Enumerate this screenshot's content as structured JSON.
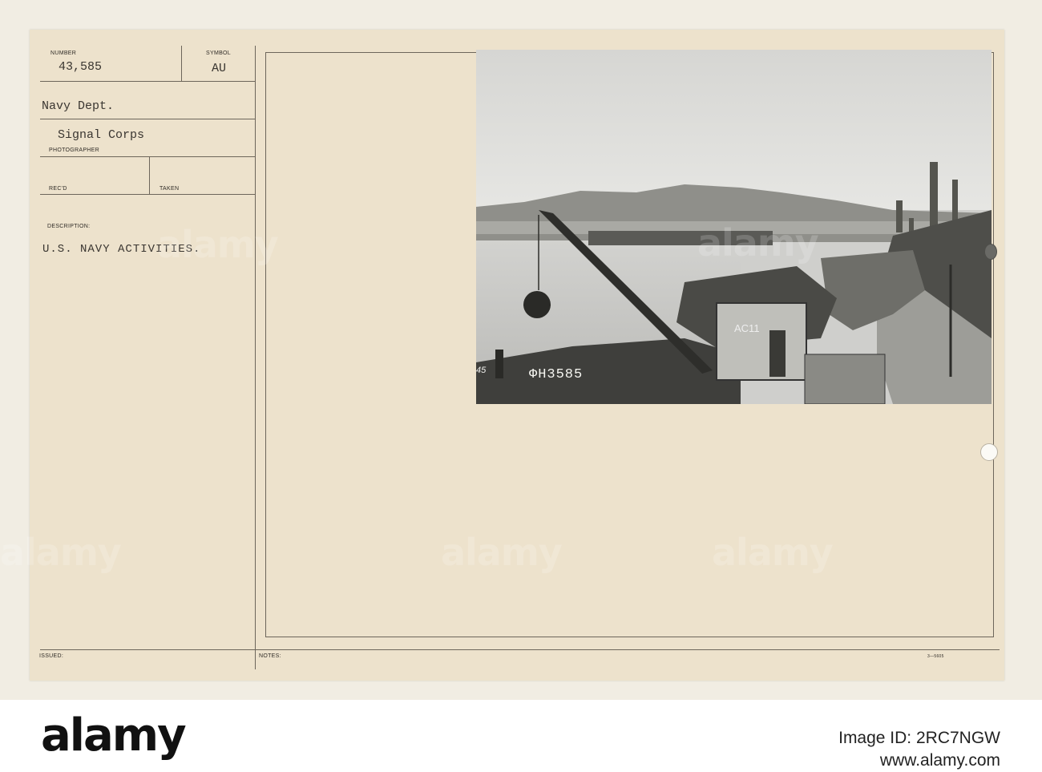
{
  "card": {
    "number_label": "NUMBER",
    "number_value": "43,585",
    "symbol_label": "SYMBOL",
    "symbol_value": "AU",
    "dept": "Navy Dept.",
    "corps": "Signal Corps",
    "photographer_label": "PHOTOGRAPHER",
    "recd_label": "REC'D",
    "taken_label": "TAKEN",
    "description_label": "DESCRIPTION:",
    "description_value": "U.S. NAVY ACTIVITIES.",
    "issued_label": "ISSUED:",
    "notes_label": "NOTES:",
    "form_code": "3—5605"
  },
  "photo": {
    "negative_number": "ΦH3585",
    "crane_marking": "AC11",
    "edge_marking": "45"
  },
  "watermark": "alamy",
  "footer": {
    "logo": "alamy",
    "image_id_line": "Image ID: 2RC7NGW",
    "site": "www.alamy.com"
  }
}
